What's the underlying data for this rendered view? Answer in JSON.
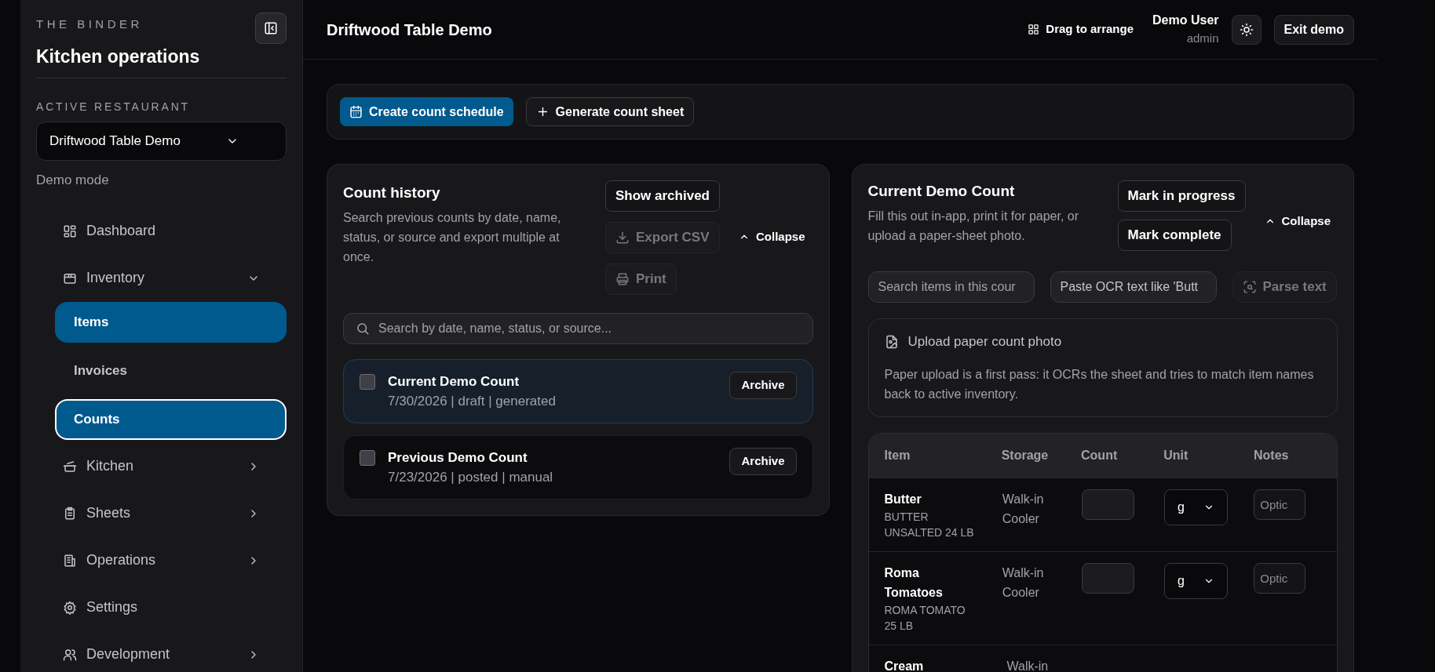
{
  "sidebar": {
    "brand": "THE BINDER",
    "title": "Kitchen operations",
    "restaurant_label": "ACTIVE RESTAURANT",
    "restaurant": "Driftwood Table Demo",
    "mode": "Demo mode",
    "items": [
      {
        "label": "Dashboard"
      },
      {
        "label": "Inventory",
        "expanded": true,
        "children": [
          {
            "label": "Items",
            "selected": true,
            "focused": false
          },
          {
            "label": "Invoices",
            "selected": false,
            "focused": false
          },
          {
            "label": "Counts",
            "selected": true,
            "focused": true
          }
        ]
      },
      {
        "label": "Kitchen",
        "expanded": false
      },
      {
        "label": "Sheets",
        "expanded": false
      },
      {
        "label": "Operations",
        "expanded": false
      },
      {
        "label": "Settings"
      },
      {
        "label": "Development",
        "expanded": false
      }
    ]
  },
  "header": {
    "title": "Driftwood Table Demo",
    "arrange": "Drag to arrange",
    "user": "Demo User",
    "role": "admin",
    "exit": "Exit demo"
  },
  "toolbar": [
    {
      "label": "Create count schedule",
      "primary": true
    },
    {
      "label": "Generate count sheet",
      "primary": false
    }
  ],
  "history": {
    "title": "Count history",
    "description": "Search previous counts by date, name, status, or source and export multiple at once.",
    "buttons": [
      {
        "label": "Show archived",
        "disabled": false
      },
      {
        "label": "Export CSV",
        "disabled": true
      },
      {
        "label": "Print",
        "disabled": true
      }
    ],
    "collapse": "Collapse",
    "search_placeholder": "Search by date, name, status, or source...",
    "counts": [
      {
        "name": "Current Demo Count",
        "meta": "7/30/2026 | draft | generated",
        "checked": false,
        "selected": true,
        "action": "Archive"
      },
      {
        "name": "Previous Demo Count",
        "meta": "7/23/2026 | posted | manual",
        "checked": false,
        "selected": false,
        "action": "Archive"
      }
    ]
  },
  "current": {
    "title": "Current Demo Count",
    "description": "Fill this out in-app, print it for paper, or upload a paper-sheet photo.",
    "buttons": [
      "Mark in progress",
      "Mark complete"
    ],
    "collapse": "Collapse",
    "search_placeholder": "Search items in this cour",
    "ocr_placeholder": "Paste OCR text like 'Butt",
    "parse": {
      "label": "Parse text",
      "disabled": true
    },
    "upload": {
      "label": "Upload paper count photo",
      "note": "Paper upload is a first pass: it OCRs the sheet and tries to match item names back to active inventory."
    },
    "table": {
      "columns": [
        "Item",
        "Storage",
        "Count",
        "Unit",
        "Notes"
      ],
      "rows": [
        {
          "item": "Butter",
          "sku": "BUTTER UNSALTED 24 LB",
          "storage": "Walk-in Cooler",
          "unit": "g",
          "notes_placeholder": "Optic"
        },
        {
          "item": "Roma Tomatoes",
          "sku": "ROMA TOMATO 25 LB",
          "storage": "Walk-in Cooler",
          "unit": "g",
          "notes_placeholder": "Optic"
        },
        {
          "item": "Cream",
          "storage": "Walk-in"
        }
      ]
    }
  }
}
